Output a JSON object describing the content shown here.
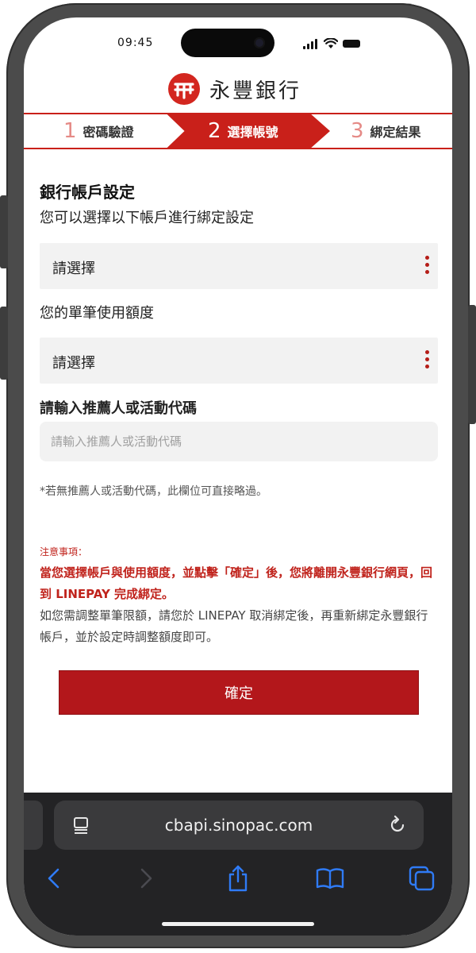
{
  "status_bar": {
    "time": "09:45"
  },
  "brand": {
    "name": "永豐銀行",
    "logo_letters": "SP",
    "color": "#d3261f"
  },
  "stepper": {
    "steps": [
      {
        "number": "1",
        "label": "密碼驗證",
        "active": false
      },
      {
        "number": "2",
        "label": "選擇帳號",
        "active": true
      },
      {
        "number": "3",
        "label": "綁定結果",
        "active": false
      }
    ]
  },
  "form": {
    "title": "銀行帳戶設定",
    "subtitle": "您可以選擇以下帳戶進行綁定設定",
    "account_select": {
      "value": "請選擇"
    },
    "limit_label": "您的單筆使用額度",
    "limit_select": {
      "value": "請選擇"
    },
    "referral_label": "請輸入推薦人或活動代碼",
    "referral_input": {
      "value": "",
      "placeholder": "請輸入推薦人或活動代碼"
    },
    "referral_hint": "*若無推薦人或活動代碼，此欄位可直接略過。"
  },
  "notice": {
    "title": "注意事項：",
    "warning": "當您選擇帳戶與使用額度，並點擊「確定」後，您將離開永豐銀行網頁，回到 LINEPAY 完成綁定。",
    "info": "如您需調整單筆限額，請您於 LINEPAY 取消綁定後，再重新綁定永豐銀行帳戶，並於設定時調整額度即可。"
  },
  "confirm_button": {
    "label": "確定"
  },
  "browser": {
    "url": "cbapi.sinopac.com"
  },
  "colors": {
    "accent": "#c9201a",
    "button": "#b3171b"
  }
}
